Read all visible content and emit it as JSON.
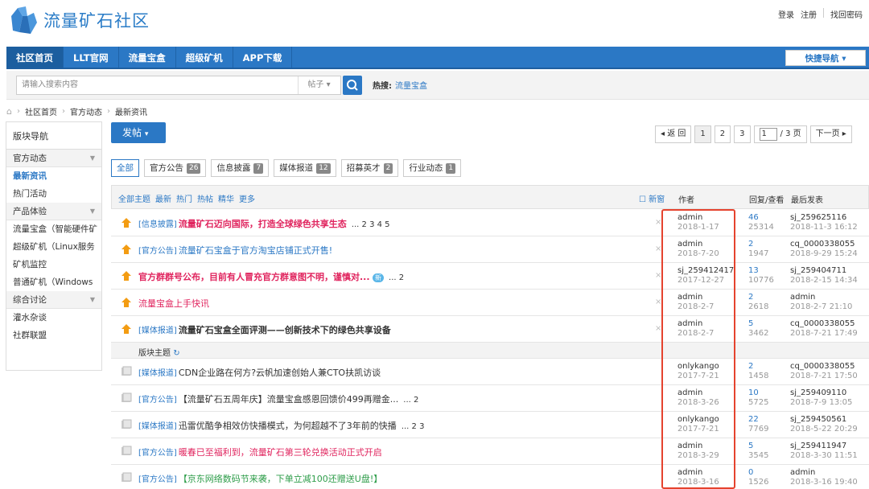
{
  "site": {
    "logo_text": "流量矿石社区"
  },
  "userlinks": [
    "登录",
    "注册",
    "找回密码"
  ],
  "nav": {
    "items": [
      "社区首页",
      "LLT官网",
      "流量宝盒",
      "超级矿机",
      "APP下载"
    ],
    "quicknav": "快捷导航"
  },
  "search": {
    "placeholder": "请输入搜索内容",
    "type": "帖子",
    "hot_label": "热搜:",
    "hot_link": "流量宝盒"
  },
  "breadcrumb": [
    "社区首页",
    "官方动态",
    "最新资讯"
  ],
  "sidebar": {
    "title": "版块导航",
    "groups": [
      {
        "label": "官方动态",
        "items": [
          "最新资讯",
          "热门活动"
        ]
      },
      {
        "label": "产品体验",
        "items": [
          "流量宝盒（智能硬件矿",
          "超级矿机（Linux服务",
          "矿机监控",
          "普通矿机（Windows"
        ]
      },
      {
        "label": "综合讨论",
        "items": [
          "灌水杂谈",
          "社群联盟"
        ]
      }
    ]
  },
  "post_button": "发帖",
  "pager": {
    "back": "◂ 返 回",
    "pages": [
      "1",
      "2",
      "3"
    ],
    "current": "1",
    "total": "/ 3 页",
    "next": "下一页 ▸"
  },
  "filters": [
    {
      "label": "全部",
      "count": ""
    },
    {
      "label": "官方公告",
      "count": "26"
    },
    {
      "label": "信息披露",
      "count": "7"
    },
    {
      "label": "媒体报道",
      "count": "12"
    },
    {
      "label": "招募英才",
      "count": "2"
    },
    {
      "label": "行业动态",
      "count": "1"
    }
  ],
  "thead": {
    "links": [
      "全部主题",
      "最新",
      "热门",
      "热帖",
      "精华",
      "更多"
    ],
    "newwin": "新窗",
    "author": "作者",
    "reply": "回复/查看",
    "last": "最后发表"
  },
  "rows": [
    {
      "cat": "[信息披露]",
      "title": "流量矿石迈向国际，打造全球绿色共享生态",
      "style": "red",
      "pages": "... 2 3 4 5",
      "author": "admin",
      "adate": "2018-1-17",
      "replies": "46",
      "views": "25314",
      "last": "sj_259625116",
      "ldate": "2018-11-3 16:12"
    },
    {
      "cat": "[官方公告]",
      "title": "流量矿石宝盒于官方淘宝店铺正式开售!",
      "style": "blue",
      "pages": "",
      "author": "admin",
      "adate": "2018-7-20",
      "replies": "2",
      "views": "1947",
      "last": "cq_0000338055",
      "ldate": "2018-9-29 15:24"
    },
    {
      "cat": "",
      "title": "官方群群号公布，目前有人冒充官方群意图不明，谨慎对...",
      "style": "red",
      "pages": "... 2",
      "newtag": "新",
      "author": "sj_259412417",
      "adate": "2017-12-27",
      "replies": "13",
      "views": "10776",
      "last": "sj_259404711",
      "ldate": "2018-2-15 14:34"
    },
    {
      "cat": "",
      "title": "流量宝盒上手快讯",
      "style": "pink",
      "pages": "",
      "author": "admin",
      "adate": "2018-2-7",
      "replies": "2",
      "views": "2618",
      "last": "admin",
      "ldate": "2018-2-7 21:10"
    },
    {
      "cat": "[媒体报道]",
      "title": "流量矿石宝盒全面评测——创新技术下的绿色共享设备",
      "style": "bold",
      "pages": "",
      "author": "admin",
      "adate": "2018-2-7",
      "replies": "5",
      "views": "3462",
      "last": "cq_0000338055",
      "ldate": "2018-7-21 17:49"
    }
  ],
  "subheader": "版块主题",
  "rows2": [
    {
      "cat": "[媒体报道]",
      "title": "CDN企业路在何方?云帆加速创始人兼CTO扶凯访谈",
      "style": "plain",
      "pages": "",
      "author": "onlykango",
      "adate": "2017-7-21",
      "replies": "2",
      "views": "1458",
      "last": "cq_0000338055",
      "ldate": "2018-7-21 17:50"
    },
    {
      "cat": "[官方公告]",
      "title": "【流量矿石五周年庆】流量宝盒感恩回馈价499再赠金...",
      "style": "plain",
      "pages": "... 2",
      "author": "admin",
      "adate": "2018-3-26",
      "replies": "10",
      "views": "5725",
      "last": "sj_259409110",
      "ldate": "2018-7-9 13:05"
    },
    {
      "cat": "[媒体报道]",
      "title": "迅雷优酷争相效仿快播模式，为何超越不了3年前的快播",
      "style": "plain",
      "pages": "... 2 3",
      "author": "onlykango",
      "adate": "2017-7-21",
      "replies": "22",
      "views": "7769",
      "last": "sj_259450561",
      "ldate": "2018-5-22 20:29"
    },
    {
      "cat": "[官方公告]",
      "title": "暖春已至福利到，流量矿石第三轮兑换活动正式开启",
      "style": "pink",
      "pages": "",
      "author": "admin",
      "adate": "2018-3-29",
      "replies": "5",
      "views": "3545",
      "last": "sj_259411947",
      "ldate": "2018-3-30 11:51"
    },
    {
      "cat": "[官方公告]",
      "title": "【京东网络数码节来袭，下单立减100还赠送U盘!】",
      "style": "green",
      "pages": "",
      "author": "admin",
      "adate": "2018-3-16",
      "replies": "0",
      "views": "1526",
      "last": "admin",
      "ldate": "2018-3-16 19:40"
    }
  ],
  "colors": {
    "brand": "#2b78c5",
    "accent_red": "#e0245e",
    "highlight": "#e5432e"
  }
}
